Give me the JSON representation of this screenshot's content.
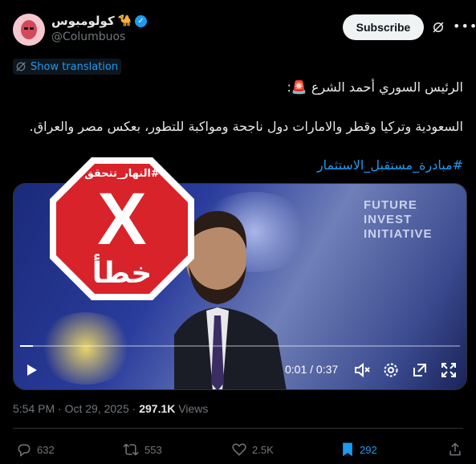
{
  "header": {
    "display_name": "كولومبوس",
    "name_emoji": "🐪",
    "handle": "@Columbuos",
    "subscribe_label": "Subscribe"
  },
  "translation": {
    "label": "Show translation"
  },
  "post": {
    "line1": "الرئيس السوري أحمد الشرع 🚨:",
    "line2": "السعودية وتركيا وقطر والامارات دول ناجحة ومواكبة للتطور، بعكس مصر والعراق.",
    "hashtag": "#مبادرة_مستقبل_الاستثمار"
  },
  "stamp": {
    "top_text": "#النهار_تتحقق",
    "mark": "X",
    "bottom_text": "خطأ",
    "color": "#d8232a"
  },
  "video": {
    "time": "0:01 / 0:37",
    "progress": 0.03,
    "backdrop_text": [
      "FUTURE",
      "INVEST",
      "INITIATIVE"
    ]
  },
  "meta": {
    "time": "5:54 PM",
    "date": "Oct 29, 2025",
    "views_count": "297.1K",
    "views_label": "Views"
  },
  "actions": {
    "replies": "632",
    "reposts": "553",
    "likes": "2.5K",
    "bookmarks": "292"
  }
}
